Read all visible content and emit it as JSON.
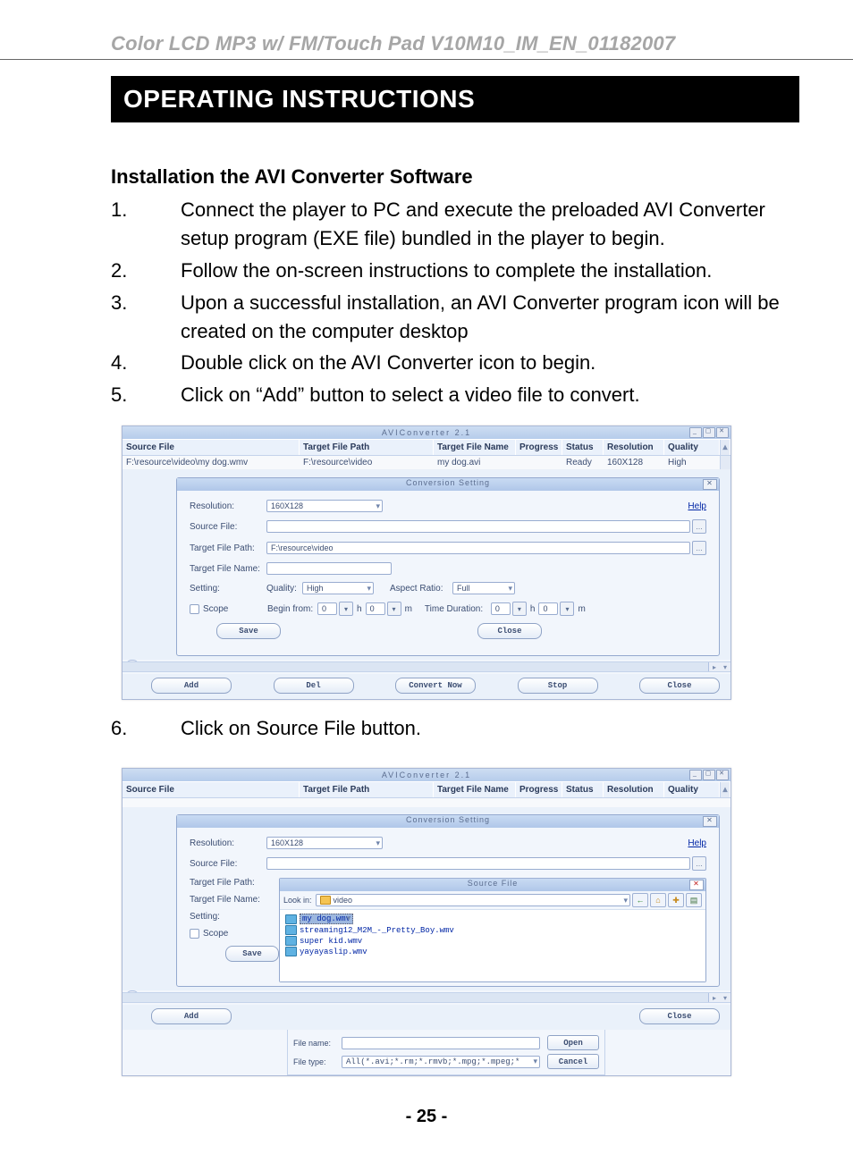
{
  "header": "Color LCD MP3 w/ FM/Touch Pad    V10M10_IM_EN_01182007",
  "section_title": "OPERATING INSTRUCTIONS",
  "sub_title": "Installation the AVI Converter Software",
  "steps": [
    "Connect the player to PC and execute the preloaded AVI Converter setup program (EXE file) bundled in the player to begin.",
    "Follow the on-screen instructions to complete the installation.",
    "Upon a successful installation, an AVI Converter program icon will be created on the computer desktop",
    "Double click on the AVI Converter icon to begin.",
    "Click on “Add” button to select a video file to convert."
  ],
  "step6": "Click on Source File button.",
  "page_number": "- 25 -",
  "app": {
    "title": "AVIConverter 2.1",
    "columns": {
      "src": "Source File",
      "path": "Target File Path",
      "tname": "Target File Name",
      "prog": "Progress",
      "stat": "Status",
      "res": "Resolution",
      "qual": "Quality"
    },
    "row": {
      "src": "F:\\resource\\video\\my dog.wmv",
      "path": "F:\\resource\\video",
      "tname": "my dog.avi",
      "prog": "",
      "stat": "Ready",
      "res": "160X128",
      "qual": "High"
    },
    "buttons": {
      "add": "Add",
      "del": "Del",
      "conv": "Convert Now",
      "stop": "Stop",
      "close": "Close"
    }
  },
  "dlg": {
    "title": "Conversion Setting",
    "labels": {
      "resolution": "Resolution:",
      "source": "Source File:",
      "path": "Target File Path:",
      "name": "Target File Name:",
      "setting": "Setting:",
      "quality": "Quality:",
      "aspect": "Aspect Ratio:",
      "scope": "Scope",
      "begin": "Begin from:",
      "duration": "Time Duration:",
      "h": "h",
      "m": "m"
    },
    "values": {
      "resolution": "160X128",
      "path": "F:\\resource\\video",
      "quality": "High",
      "aspect": "Full",
      "zero": "0"
    },
    "help": "Help",
    "save": "Save",
    "close": "Close"
  },
  "file_dialog": {
    "title": "Source File",
    "lookin": "Look in:",
    "folder": "video",
    "files": [
      "my dog.wmv",
      "streaming12_M2M_-_Pretty_Boy.wmv",
      "super kid.wmv",
      "yayayaslip.wmv"
    ],
    "filename_lbl": "File name:",
    "filetype_lbl": "File type:",
    "filetype_val": "All(*.avi;*.rm;*.rmvb;*.mpg;*.mpeg;*",
    "open": "Open",
    "cancel": "Cancel"
  }
}
